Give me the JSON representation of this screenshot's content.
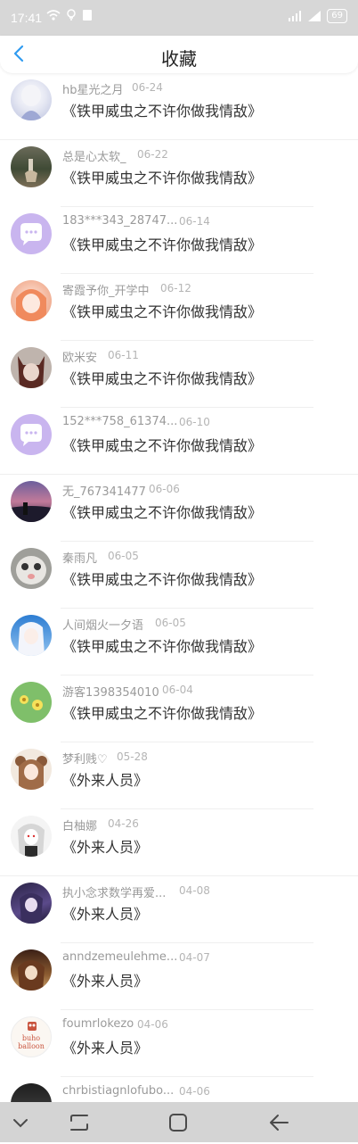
{
  "status_bar": {
    "time": "17:41",
    "battery": "69"
  },
  "header": {
    "title": "收藏"
  },
  "items": [
    {
      "user": "hb星光之月",
      "date": "06-24",
      "work": "《铁甲威虫之不许你做我情敌》",
      "avatar": "anime-girl-white-hair"
    },
    {
      "user": "总是心太软_",
      "date": "06-22",
      "work": "《铁甲威虫之不许你做我情敌》",
      "avatar": "deer-forest"
    },
    {
      "user": "183***343_28747...",
      "date": "06-14",
      "work": "《铁甲威虫之不许你做我情敌》",
      "avatar": "default-chat-avatar"
    },
    {
      "user": "寄霞予你_开学中",
      "date": "06-12",
      "work": "《铁甲威虫之不许你做我情敌》",
      "avatar": "anime-girl-orange-hair"
    },
    {
      "user": "欧米安",
      "date": "06-11",
      "work": "《铁甲威虫之不许你做我情敌》",
      "avatar": "anime-cat-ears"
    },
    {
      "user": "152***758_61374...",
      "date": "06-10",
      "work": "《铁甲威虫之不许你做我情敌》",
      "avatar": "default-chat-avatar"
    },
    {
      "user": "无_767341477",
      "date": "06-06",
      "work": "《铁甲威虫之不许你做我情敌》",
      "avatar": "sunset-sea"
    },
    {
      "user": "秦雨凡",
      "date": "06-05",
      "work": "《铁甲威虫之不许你做我情敌》",
      "avatar": "grey-cat"
    },
    {
      "user": "人间烟火一夕语",
      "date": "06-05",
      "work": "《铁甲威虫之不许你做我情敌》",
      "avatar": "anime-girl-blue"
    },
    {
      "user": "游客1398354010",
      "date": "06-04",
      "work": "《铁甲威虫之不许你做我情敌》",
      "avatar": "yellow-flowers"
    },
    {
      "user": "梦利贱♡",
      "date": "05-28",
      "work": "《外来人员》",
      "avatar": "anime-girl-bear"
    },
    {
      "user": "白柚娜",
      "date": "04-26",
      "work": "《外来人员》",
      "avatar": "anime-girl-silver"
    },
    {
      "user": "执小念求数学再爱...",
      "date": "04-08",
      "work": "《外来人员》",
      "avatar": "anime-dark-purple"
    },
    {
      "user": "anndzemeulehme...",
      "date": "04-07",
      "work": "《外来人员》",
      "avatar": "anime-brown"
    },
    {
      "user": "foumrlokezo",
      "date": "04-06",
      "work": "《外来人员》",
      "avatar": "buho-balloon-logo",
      "avatar_text": "buho balloon"
    },
    {
      "user": "chrbistiagnlofubo...",
      "date": "04-06",
      "work": "",
      "avatar": "dark-photo"
    }
  ],
  "nav": {
    "buttons": [
      "chevron-down-icon",
      "recent-apps-icon",
      "home-icon",
      "back-icon"
    ]
  }
}
